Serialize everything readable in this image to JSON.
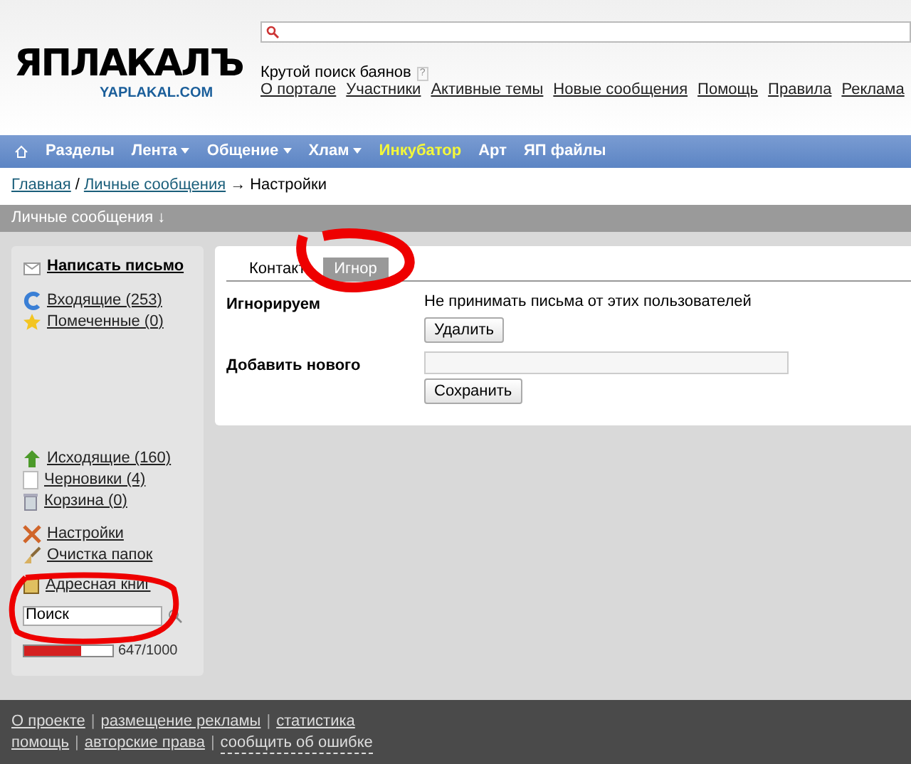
{
  "header": {
    "logo": "ЯПЛАКАЛЪ",
    "logo_sub": "YAPLAKAL.COM",
    "search_hint": "Крутой поиск баянов",
    "help_mark": "?",
    "links": [
      "О портале",
      "Участники",
      "Активные темы",
      "Новые сообщения",
      "Помощь",
      "Правила",
      "Реклама"
    ]
  },
  "nav": [
    {
      "label": "Разделы",
      "dropdown": false,
      "highlight": false
    },
    {
      "label": "Лента",
      "dropdown": true,
      "highlight": false
    },
    {
      "label": "Общение",
      "dropdown": true,
      "highlight": false
    },
    {
      "label": "Хлам",
      "dropdown": true,
      "highlight": false
    },
    {
      "label": "Инкубатор",
      "dropdown": false,
      "highlight": true
    },
    {
      "label": "Арт",
      "dropdown": false,
      "highlight": false
    },
    {
      "label": "ЯП файлы",
      "dropdown": false,
      "highlight": false
    }
  ],
  "breadcrumb": {
    "links": [
      "Главная",
      "Личные сообщения"
    ],
    "separator": "/",
    "arrow": "→",
    "current": "Настройки"
  },
  "section_title": "Личные сообщения ↓",
  "sidebar": {
    "compose": {
      "label": "Написать письмо"
    },
    "groups": [
      [
        {
          "label": "Входящие (253)"
        },
        {
          "label": "Помеченные (0)"
        }
      ],
      [
        {
          "label": "Исходящие (160)"
        },
        {
          "label": "Черновики (4)"
        },
        {
          "label": "Корзина (0)"
        }
      ],
      [
        {
          "label": "Настройки"
        },
        {
          "label": "Очистка папок"
        },
        {
          "label": "Адресная книг"
        }
      ]
    ],
    "search": {
      "value": "Поиск"
    },
    "quota": {
      "level": 0.647,
      "reading": "647/1000"
    }
  },
  "panel": {
    "tabs": [
      {
        "label": "Контакт",
        "selected": false
      },
      {
        "label": "Игнор",
        "selected": true
      }
    ],
    "rows": [
      {
        "label": "Игнорируем",
        "text": "Не принимать письма от этих пользователей",
        "button": "Удалить",
        "kind": "list"
      },
      {
        "label": "Добавить нового",
        "button": "Сохранить",
        "kind": "input"
      }
    ]
  },
  "footer_separator": "|",
  "footer": [
    [
      "О проекте",
      "размещение рекламы",
      "статистика"
    ],
    [
      "помощь",
      "авторские права",
      "сообщить об ошибке"
    ]
  ]
}
